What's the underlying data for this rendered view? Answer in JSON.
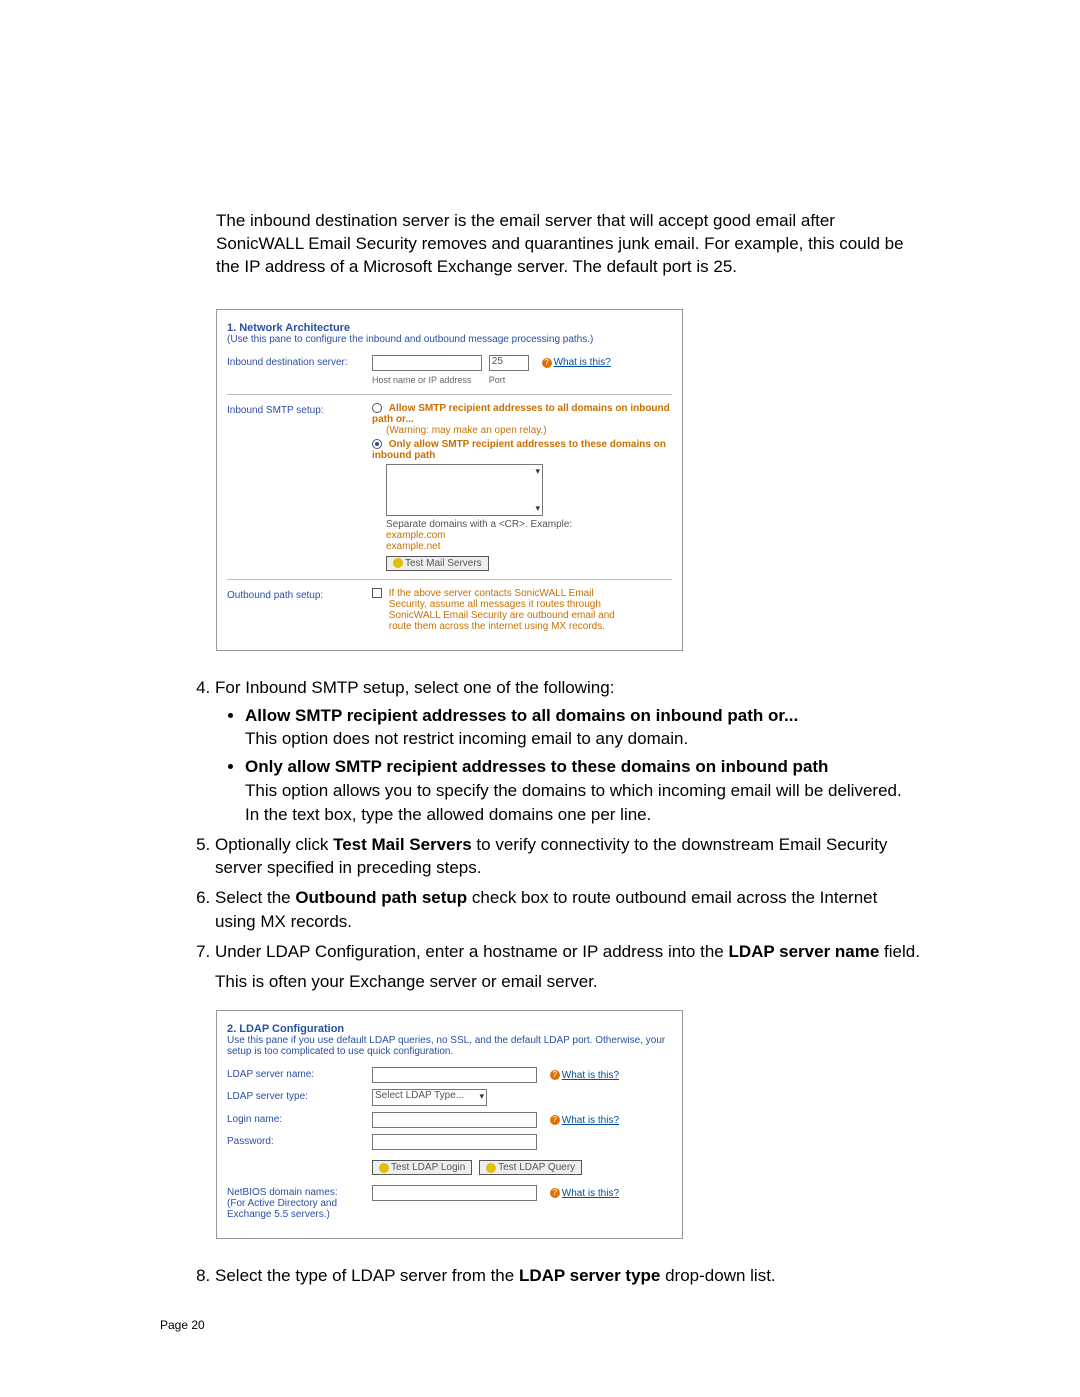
{
  "intro": "The inbound destination server is the email server that will accept good email after SonicWALL Email Security removes and quarantines junk email. For example, this could be the IP address of a Microsoft Exchange server. The default port is 25.",
  "screenshot1": {
    "title": "1. Network Architecture",
    "subtitle": "(Use this pane to configure the inbound and outbound message processing paths.)",
    "row_inbound_dest": {
      "label": "Inbound destination server:",
      "host_value": "",
      "port_value": "25",
      "host_caption": "Host name or IP address",
      "port_caption": "Port",
      "help": "What is this?"
    },
    "row_inbound_smtp": {
      "label": "Inbound SMTP setup:",
      "option1": "Allow SMTP recipient addresses to all domains on inbound path or...",
      "option1_note": "(Warning: may make an open relay.)",
      "option2": "Only allow SMTP recipient addresses to these domains on inbound path",
      "textarea_note": "Separate domains with a <CR>. Example:",
      "example1": "example.com",
      "example2": "example.net",
      "btn": "Test Mail Servers"
    },
    "row_outbound": {
      "label": "Outbound path setup:",
      "text": "If the above server contacts SonicWALL Email Security, assume all messages it routes through SonicWALL Email Security are outbound email and route them across the internet using MX records."
    }
  },
  "step4": {
    "lead": "For Inbound SMTP setup, select one of the following:",
    "bullet1_title": "Allow SMTP recipient addresses to all domains on inbound path or...",
    "bullet1_text": "This option does not restrict incoming email to any domain.",
    "bullet2_title": "Only allow SMTP recipient addresses to these domains on inbound path",
    "bullet2_text": "This option allows you to specify the domains to which incoming email will be delivered. In the text box, type the allowed domains one per line."
  },
  "step5_pre": "Optionally click ",
  "step5_bold": "Test Mail Servers",
  "step5_post": " to verify connectivity to the downstream Email Security server specified in preceding steps.",
  "step6_pre": "Select the ",
  "step6_bold": "Outbound path setup",
  "step6_post": " check box to route outbound email across the Internet using MX records.",
  "step7_pre": "Under LDAP Configuration, enter a hostname or IP address into the ",
  "step7_bold": "LDAP server name",
  "step7_post": " field.",
  "step7_note": "This is often your Exchange server or email server.",
  "screenshot2": {
    "title": "2. LDAP Configuration",
    "subtitle": "Use this pane if you use default LDAP queries, no SSL, and the default LDAP port. Otherwise, your setup is too complicated to use quick configuration.",
    "rows": {
      "server_name": "LDAP server name:",
      "server_type": "LDAP server type:",
      "server_type_value": "Select LDAP Type...",
      "login": "Login name:",
      "password": "Password:",
      "btn1": "Test LDAP Login",
      "btn2": "Test LDAP Query",
      "netbios": "NetBIOS domain names:",
      "netbios_note": "(For Active Directory and Exchange 5.5 servers.)",
      "help": "What is this?"
    }
  },
  "step8_pre": "Select the type of LDAP server from the ",
  "step8_bold": "LDAP server type",
  "step8_post": " drop-down list.",
  "footer": "Page 20"
}
